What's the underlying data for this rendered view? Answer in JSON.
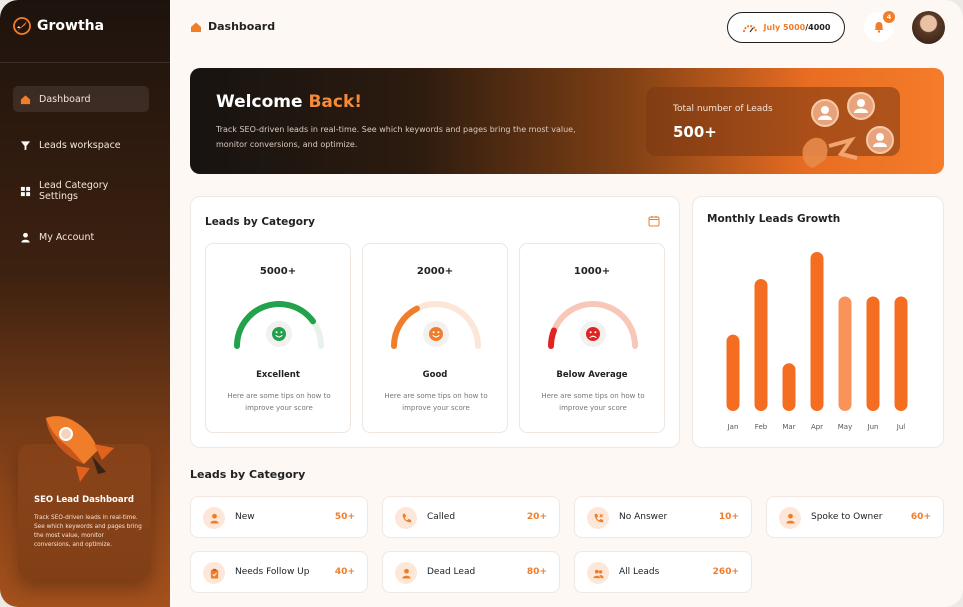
{
  "app": {
    "name": "Growtha"
  },
  "sidebar": {
    "items": [
      {
        "label": "Dashboard",
        "icon": "home-icon",
        "active": true
      },
      {
        "label": "Leads workspace",
        "icon": "filter-icon",
        "active": false
      },
      {
        "label": "Lead Category Settings",
        "icon": "grid-icon",
        "active": false
      },
      {
        "label": "My Account",
        "icon": "user-icon",
        "active": false
      }
    ],
    "promo": {
      "title": "SEO Lead Dashboard",
      "text": "Track SEO-driven leads in real-time. See which keywords and pages bring the most value, monitor conversions, and optimize."
    }
  },
  "header": {
    "breadcrumb": "Dashboard",
    "plan": {
      "month": "July",
      "used": "5000",
      "limit": "/4000"
    },
    "notifications": "4"
  },
  "hero": {
    "title_a": "Welcome",
    "title_b": "Back!",
    "subtitle": "Track SEO-driven leads in real-time. See which keywords and pages bring the most value, monitor conversions, and optimize.",
    "card_label": "Total number of Leads",
    "card_value": "500+"
  },
  "category_panel": {
    "title": "Leads by Category",
    "gauges": [
      {
        "value": "5000+",
        "name": "Excellent",
        "tip": "Here are some tips on how to improve your score",
        "level": 0.8,
        "color": "#22a24a",
        "track": "#e7f3ea",
        "face": "smile"
      },
      {
        "value": "2000+",
        "name": "Good",
        "tip": "Here are some tips on how to improve your score",
        "level": 0.35,
        "color": "#f07d2a",
        "track": "#fbe6d8",
        "face": "smile"
      },
      {
        "value": "1000+",
        "name": "Below Average",
        "tip": "Here are some tips on how to improve your score",
        "level": 0.12,
        "color": "#e02424",
        "track": "#f8c7b8",
        "face": "frown"
      }
    ]
  },
  "chart_data": {
    "type": "bar",
    "title": "Monthly Leads Growth",
    "categories": [
      "Jan",
      "Feb",
      "Mar",
      "Apr",
      "May",
      "Jun",
      "Jul"
    ],
    "values": [
      48,
      83,
      30,
      100,
      72,
      72,
      72
    ],
    "ylim": [
      0,
      100
    ],
    "grid": false,
    "colors": {
      "bar": "#f46d21",
      "highlight": "#f9935a"
    }
  },
  "leads_section": {
    "title": "Leads by Category",
    "items": [
      {
        "label": "New",
        "count": "50+",
        "icon": "user-icon"
      },
      {
        "label": "Called",
        "count": "20+",
        "icon": "phone-icon"
      },
      {
        "label": "No Answer",
        "count": "10+",
        "icon": "phone-missed-icon"
      },
      {
        "label": "Spoke to Owner",
        "count": "60+",
        "icon": "user-icon"
      },
      {
        "label": "Needs Follow Up",
        "count": "40+",
        "icon": "clipboard-icon"
      },
      {
        "label": "Dead Lead",
        "count": "80+",
        "icon": "user-icon"
      },
      {
        "label": "All Leads",
        "count": "260+",
        "icon": "users-icon"
      }
    ]
  },
  "colors": {
    "accent": "#f07d2a"
  }
}
